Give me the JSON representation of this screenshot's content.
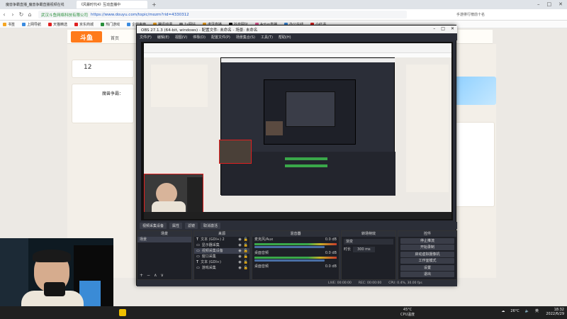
{
  "browser": {
    "tabs": [
      {
        "label": "魔兽争霸直播_魔兽争霸直播视频在线",
        "active": false
      },
      {
        "label": "《风暴时代4》互动直播中",
        "active": true
      }
    ],
    "address": {
      "site_label": "武汉斗鱼网络科技有限公司",
      "url": "https://www.douyu.com/topic/mozm?rid=4330312"
    },
    "right_search": "手游排行榜前十名",
    "bookmarks": [
      "书签",
      "上网导航",
      "天猫精选",
      "京东商城",
      "热门游戏",
      "企鹅电竞",
      "腾讯动漫",
      "1s网站",
      "虎牙直播",
      "抖音网址",
      "Acfun直播",
      "办公在线",
      "小红书"
    ]
  },
  "site": {
    "logo": "斗鱼",
    "nav": "首页",
    "left_count": "12",
    "left_title": "魔兽争霸："
  },
  "obs": {
    "title": "OBS 27.1.3 (64-bit, windows) - 配置文件: 未命名 - 场景: 未命名",
    "menu": [
      "文件(F)",
      "编辑(E)",
      "视图(V)",
      "停靠(D)",
      "配置文件(P)",
      "场景集合(S)",
      "工具(T)",
      "帮助(H)"
    ],
    "dock_tabs": [
      "视频采集设备",
      "属性",
      "滤镜",
      "取消激活"
    ],
    "scenes": {
      "header": "场景",
      "items": [
        "场景"
      ]
    },
    "sources": {
      "header": "来源",
      "items": [
        "文本 (GDI+) 2",
        "显示器采集",
        "视频采集设备",
        "窗口采集",
        "文本 (GDI+)",
        "游戏采集"
      ]
    },
    "mixer": {
      "header": "混音器",
      "channels": [
        {
          "name": "麦克风/Aux",
          "db": "0.0 dB"
        },
        {
          "name": "桌面音频",
          "db": "0.0 dB"
        },
        {
          "name": "桌面音频",
          "db": "0.0 dB"
        }
      ]
    },
    "transitions": {
      "header": "转场特效",
      "type": "渐变",
      "duration_label": "时长",
      "duration": "300 ms"
    },
    "controls": {
      "header": "控件",
      "buttons": [
        "停止推流",
        "开始录制",
        "启动虚拟摄像机",
        "工作室模式",
        "设置",
        "退出"
      ]
    },
    "status": [
      "LIVE: 00:00:00",
      "REC: 00:00:00",
      "CPU: 0.4%, 30.00 fps"
    ]
  },
  "taskbar": {
    "temp": "45°C",
    "cpu_label": "CPU温度",
    "weather": "26°C",
    "ime": "英",
    "time": "18:32",
    "date": "2022/6/29"
  },
  "colors": {
    "accent": "#ff7a1a",
    "live_red": "#e02020",
    "obs_bg": "#2b2e38"
  }
}
